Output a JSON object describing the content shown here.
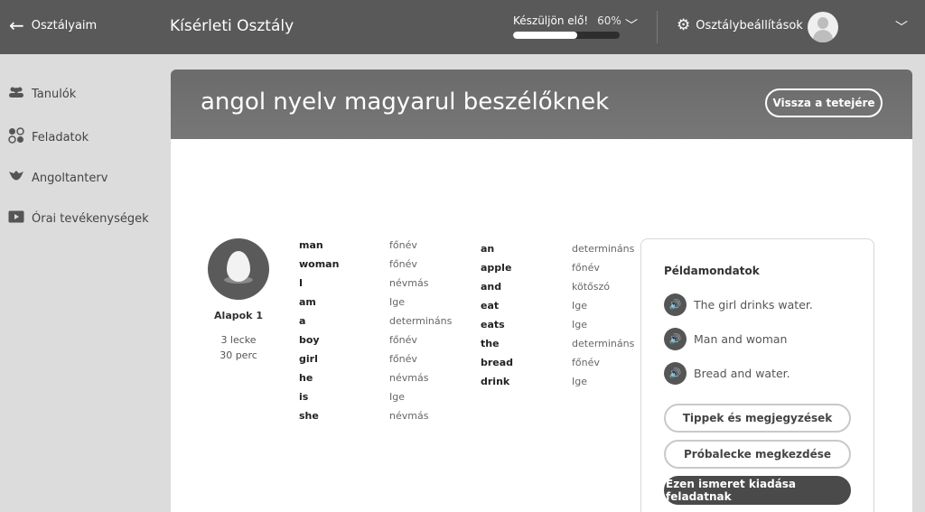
{
  "topbar": {
    "back_label": "Osztályaim",
    "class_name": "Kísérleti Osztály",
    "progress_label": "Készüljön elő!",
    "progress_pct_text": "60%",
    "progress_fraction": 0.6,
    "settings_label": "Osztálybeállítások"
  },
  "sidebar": {
    "items": [
      {
        "label": "Tanulók",
        "icon": "students-icon"
      },
      {
        "label": "Feladatok",
        "icon": "tasks-icon"
      },
      {
        "label": "Angoltanterv",
        "icon": "curriculum-icon"
      },
      {
        "label": "Órai tevékenységek",
        "icon": "play-icon"
      }
    ]
  },
  "main": {
    "title": "angol nyelv magyarul beszélőknek",
    "top_button": "Vissza a tetejére"
  },
  "skill": {
    "name": "Alapok 1",
    "lessons": "3 lecke",
    "duration": "30 perc"
  },
  "words_col1": [
    {
      "word": "man",
      "pos": "főnév"
    },
    {
      "word": "woman",
      "pos": "főnév"
    },
    {
      "word": "I",
      "pos": "névmás"
    },
    {
      "word": "am",
      "pos": "Ige"
    },
    {
      "word": "a",
      "pos": "determináns"
    },
    {
      "word": "boy",
      "pos": "főnév"
    },
    {
      "word": "girl",
      "pos": "főnév"
    },
    {
      "word": "he",
      "pos": "névmás"
    },
    {
      "word": "is",
      "pos": "Ige"
    },
    {
      "word": "she",
      "pos": "névmás"
    }
  ],
  "words_col2": [
    {
      "word": "an",
      "pos": "determináns"
    },
    {
      "word": "apple",
      "pos": "főnév"
    },
    {
      "word": "and",
      "pos": "kötőszó"
    },
    {
      "word": "eat",
      "pos": "Ige"
    },
    {
      "word": "eats",
      "pos": "Ige"
    },
    {
      "word": "the",
      "pos": "determináns"
    },
    {
      "word": "bread",
      "pos": "főnév"
    },
    {
      "word": "drink",
      "pos": "Ige"
    }
  ],
  "panel": {
    "title": "Példamondatok",
    "sentences": [
      "The girl drinks water.",
      "Man and woman",
      "Bread and water."
    ],
    "buttons": [
      "Tippek és megjegyzések",
      "Próbalecke megkezdése",
      "Ezen ismeret kiadása feladatnak"
    ]
  },
  "colors": {
    "topbar": "#595959",
    "sidebar_bg": "#dcdcdc",
    "header": "#707070",
    "accent_dark": "#4a4a4a"
  }
}
